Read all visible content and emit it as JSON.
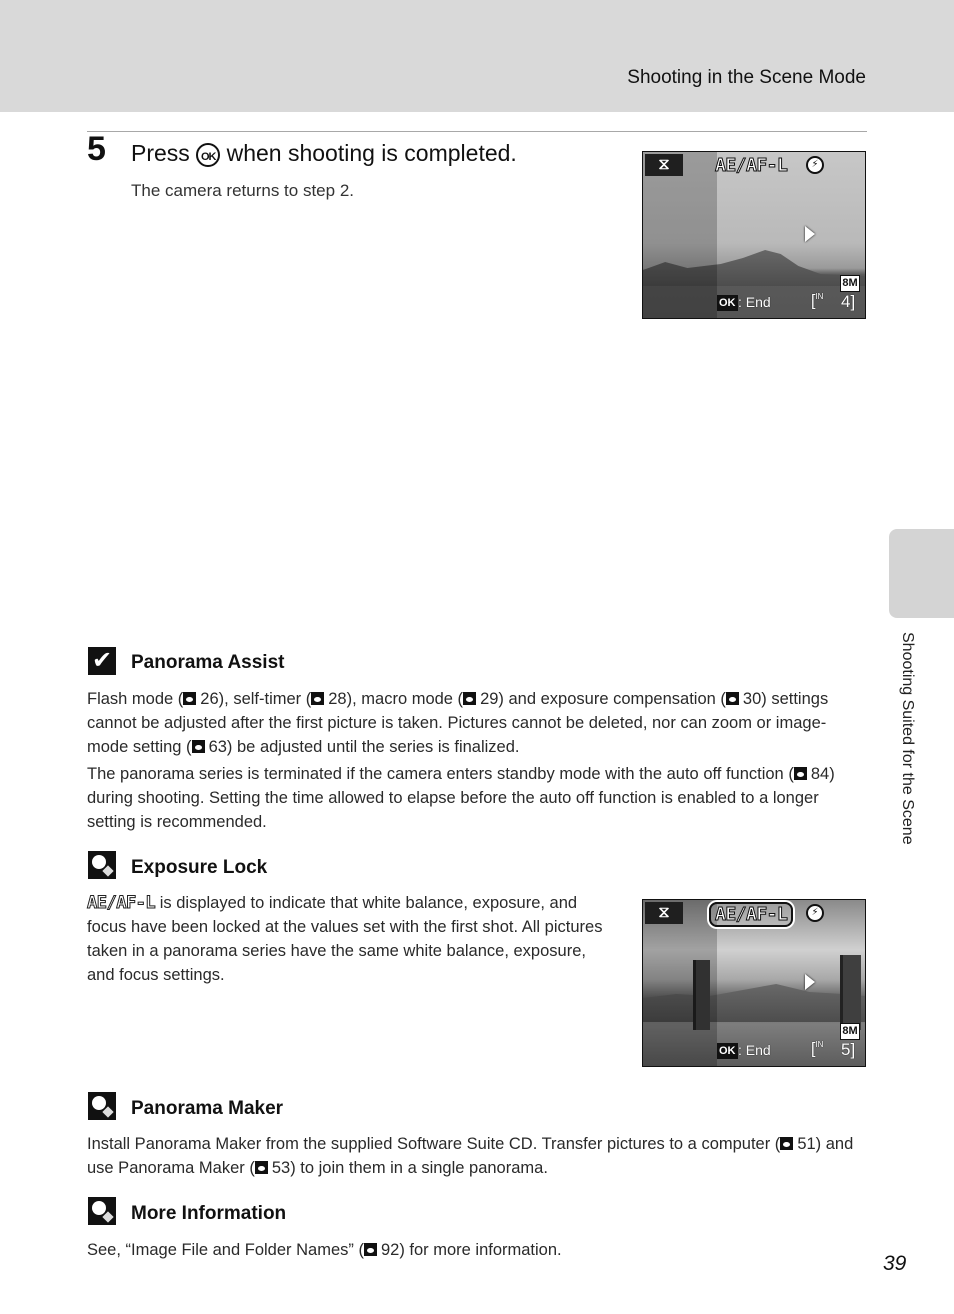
{
  "header": {
    "section_title": "Shooting in the Scene Mode"
  },
  "side_tab": {
    "label": "Shooting Suited for the Scene"
  },
  "step": {
    "number": "5",
    "title_before": "Press ",
    "title_icon": "OK",
    "title_after": " when shooting is completed.",
    "description": "The camera returns to step 2."
  },
  "lcd_screens": [
    {
      "mode_icon": "panorama-assist-icon",
      "lock_label": "AE/AF-L",
      "lock_highlighted": false,
      "flash_icon": "flash-off-icon",
      "direction_icon": "arrow-right-icon",
      "image_size": "8M",
      "ok_key": "OK",
      "ok_action": ": End",
      "memory": "IN",
      "frames_remaining": "4"
    },
    {
      "mode_icon": "panorama-assist-icon",
      "lock_label": "AE/AF-L",
      "lock_highlighted": true,
      "flash_icon": "flash-off-icon",
      "direction_icon": "arrow-right-icon",
      "image_size": "8M",
      "ok_key": "OK",
      "ok_action": ": End",
      "memory": "IN",
      "frames_remaining": "5"
    }
  ],
  "notes": {
    "panorama_assist": {
      "icon": "check-icon",
      "title": "Panorama Assist",
      "p1": {
        "t1": "Flash mode (",
        "r1": "26",
        "t2": "), self-timer (",
        "r2": "28",
        "t3": "), macro mode (",
        "r3": "29",
        "t4": ") and exposure compensation (",
        "r4": "30",
        "t5": ") settings cannot be adjusted after the first picture is taken. Pictures cannot be deleted, nor can zoom or image-mode setting (",
        "r5": "63",
        "t6": ") be adjusted until the series is finalized."
      },
      "p2": {
        "t1": "The panorama series is terminated if the camera enters standby mode with the auto off function (",
        "r1": "84",
        "t2": ") during shooting. Setting the time allowed to elapse before the auto off function is enabled to a longer setting is recommended."
      }
    },
    "exposure_lock": {
      "icon": "tip-icon",
      "title": "Exposure Lock",
      "lock_label": "AE/AF-L",
      "text": " is displayed to indicate that white balance, exposure, and focus have been locked at the values set with the first shot. All pictures taken in a panorama series have the same white balance, exposure, and focus settings."
    },
    "panorama_maker": {
      "icon": "tip-icon",
      "title": "Panorama Maker",
      "t1": "Install Panorama Maker from the supplied Software Suite CD. Transfer pictures to a computer (",
      "r1": "51",
      "t2": ") and use Panorama Maker (",
      "r2": "53",
      "t3": ") to join them in a single panorama."
    },
    "more_information": {
      "icon": "tip-icon",
      "title": "More Information",
      "t1": "See, “Image File and Folder Names” (",
      "r1": "92",
      "t2": ") for more information."
    }
  },
  "page_number": "39"
}
